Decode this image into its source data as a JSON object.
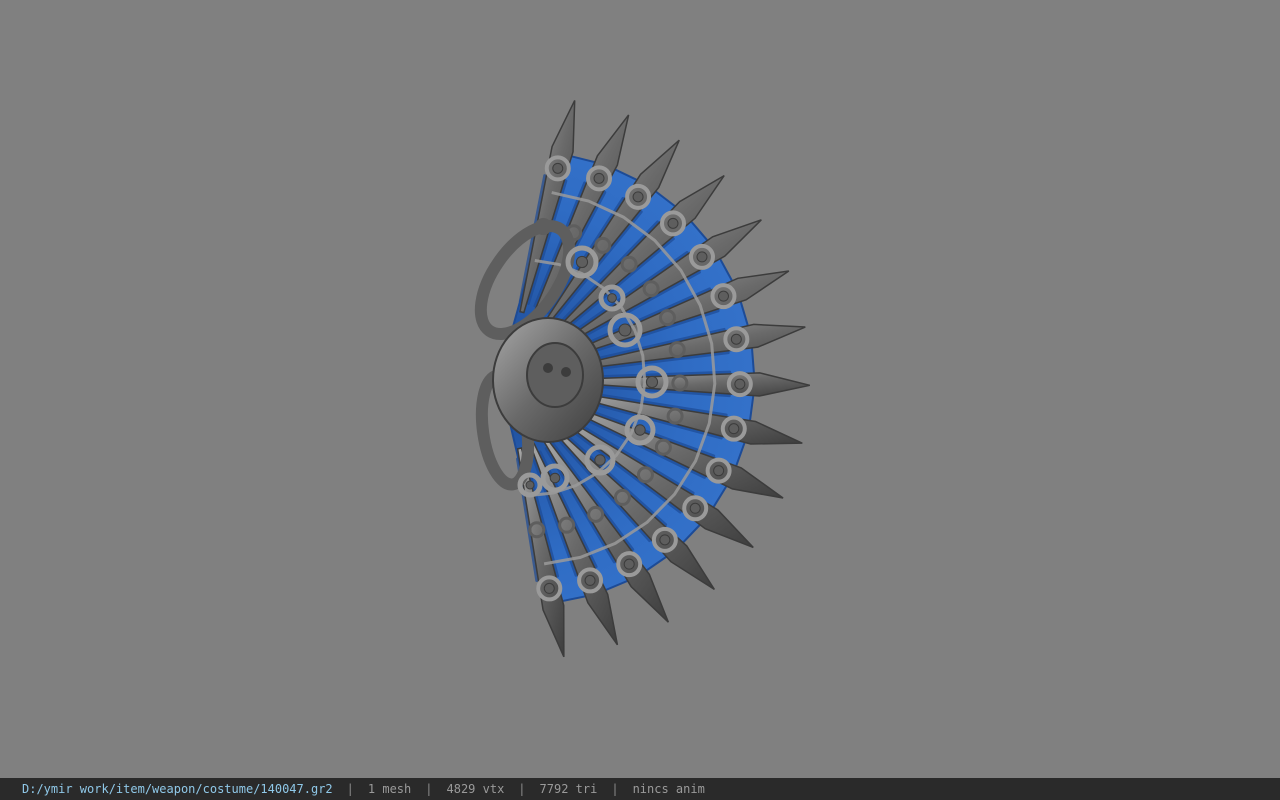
{
  "viewport": {
    "background": "#808080",
    "model_icon": "fan-model-icon",
    "colors": {
      "metal": "#5e5e5e",
      "metal_light": "#9a9a9a",
      "metal_dark": "#3c3c3c",
      "blue": "#2f6cc4",
      "blue_dark": "#1d4b96"
    }
  },
  "status": {
    "path": "D:/ymir work/item/weapon/costume/140047.gr2",
    "separator": "|",
    "mesh": "1 mesh",
    "vertices": "4829 vtx",
    "triangles": "7792 tri",
    "anim": "nincs anim"
  }
}
